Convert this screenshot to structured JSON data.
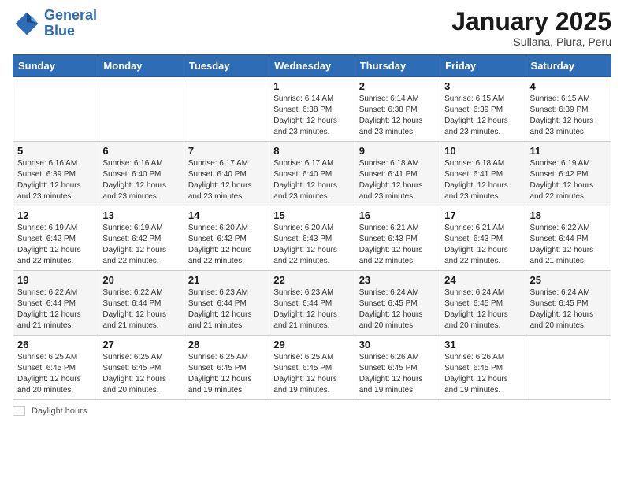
{
  "header": {
    "logo_line1": "General",
    "logo_line2": "Blue",
    "month": "January 2025",
    "location": "Sullana, Piura, Peru"
  },
  "weekdays": [
    "Sunday",
    "Monday",
    "Tuesday",
    "Wednesday",
    "Thursday",
    "Friday",
    "Saturday"
  ],
  "weeks": [
    [
      {
        "day": "",
        "info": ""
      },
      {
        "day": "",
        "info": ""
      },
      {
        "day": "",
        "info": ""
      },
      {
        "day": "1",
        "info": "Sunrise: 6:14 AM\nSunset: 6:38 PM\nDaylight: 12 hours\nand 23 minutes."
      },
      {
        "day": "2",
        "info": "Sunrise: 6:14 AM\nSunset: 6:38 PM\nDaylight: 12 hours\nand 23 minutes."
      },
      {
        "day": "3",
        "info": "Sunrise: 6:15 AM\nSunset: 6:39 PM\nDaylight: 12 hours\nand 23 minutes."
      },
      {
        "day": "4",
        "info": "Sunrise: 6:15 AM\nSunset: 6:39 PM\nDaylight: 12 hours\nand 23 minutes."
      }
    ],
    [
      {
        "day": "5",
        "info": "Sunrise: 6:16 AM\nSunset: 6:39 PM\nDaylight: 12 hours\nand 23 minutes."
      },
      {
        "day": "6",
        "info": "Sunrise: 6:16 AM\nSunset: 6:40 PM\nDaylight: 12 hours\nand 23 minutes."
      },
      {
        "day": "7",
        "info": "Sunrise: 6:17 AM\nSunset: 6:40 PM\nDaylight: 12 hours\nand 23 minutes."
      },
      {
        "day": "8",
        "info": "Sunrise: 6:17 AM\nSunset: 6:40 PM\nDaylight: 12 hours\nand 23 minutes."
      },
      {
        "day": "9",
        "info": "Sunrise: 6:18 AM\nSunset: 6:41 PM\nDaylight: 12 hours\nand 23 minutes."
      },
      {
        "day": "10",
        "info": "Sunrise: 6:18 AM\nSunset: 6:41 PM\nDaylight: 12 hours\nand 23 minutes."
      },
      {
        "day": "11",
        "info": "Sunrise: 6:19 AM\nSunset: 6:42 PM\nDaylight: 12 hours\nand 22 minutes."
      }
    ],
    [
      {
        "day": "12",
        "info": "Sunrise: 6:19 AM\nSunset: 6:42 PM\nDaylight: 12 hours\nand 22 minutes."
      },
      {
        "day": "13",
        "info": "Sunrise: 6:19 AM\nSunset: 6:42 PM\nDaylight: 12 hours\nand 22 minutes."
      },
      {
        "day": "14",
        "info": "Sunrise: 6:20 AM\nSunset: 6:42 PM\nDaylight: 12 hours\nand 22 minutes."
      },
      {
        "day": "15",
        "info": "Sunrise: 6:20 AM\nSunset: 6:43 PM\nDaylight: 12 hours\nand 22 minutes."
      },
      {
        "day": "16",
        "info": "Sunrise: 6:21 AM\nSunset: 6:43 PM\nDaylight: 12 hours\nand 22 minutes."
      },
      {
        "day": "17",
        "info": "Sunrise: 6:21 AM\nSunset: 6:43 PM\nDaylight: 12 hours\nand 22 minutes."
      },
      {
        "day": "18",
        "info": "Sunrise: 6:22 AM\nSunset: 6:44 PM\nDaylight: 12 hours\nand 21 minutes."
      }
    ],
    [
      {
        "day": "19",
        "info": "Sunrise: 6:22 AM\nSunset: 6:44 PM\nDaylight: 12 hours\nand 21 minutes."
      },
      {
        "day": "20",
        "info": "Sunrise: 6:22 AM\nSunset: 6:44 PM\nDaylight: 12 hours\nand 21 minutes."
      },
      {
        "day": "21",
        "info": "Sunrise: 6:23 AM\nSunset: 6:44 PM\nDaylight: 12 hours\nand 21 minutes."
      },
      {
        "day": "22",
        "info": "Sunrise: 6:23 AM\nSunset: 6:44 PM\nDaylight: 12 hours\nand 21 minutes."
      },
      {
        "day": "23",
        "info": "Sunrise: 6:24 AM\nSunset: 6:45 PM\nDaylight: 12 hours\nand 20 minutes."
      },
      {
        "day": "24",
        "info": "Sunrise: 6:24 AM\nSunset: 6:45 PM\nDaylight: 12 hours\nand 20 minutes."
      },
      {
        "day": "25",
        "info": "Sunrise: 6:24 AM\nSunset: 6:45 PM\nDaylight: 12 hours\nand 20 minutes."
      }
    ],
    [
      {
        "day": "26",
        "info": "Sunrise: 6:25 AM\nSunset: 6:45 PM\nDaylight: 12 hours\nand 20 minutes."
      },
      {
        "day": "27",
        "info": "Sunrise: 6:25 AM\nSunset: 6:45 PM\nDaylight: 12 hours\nand 20 minutes."
      },
      {
        "day": "28",
        "info": "Sunrise: 6:25 AM\nSunset: 6:45 PM\nDaylight: 12 hours\nand 19 minutes."
      },
      {
        "day": "29",
        "info": "Sunrise: 6:25 AM\nSunset: 6:45 PM\nDaylight: 12 hours\nand 19 minutes."
      },
      {
        "day": "30",
        "info": "Sunrise: 6:26 AM\nSunset: 6:45 PM\nDaylight: 12 hours\nand 19 minutes."
      },
      {
        "day": "31",
        "info": "Sunrise: 6:26 AM\nSunset: 6:45 PM\nDaylight: 12 hours\nand 19 minutes."
      },
      {
        "day": "",
        "info": ""
      }
    ]
  ],
  "footer": {
    "legend_label": "Daylight hours"
  }
}
